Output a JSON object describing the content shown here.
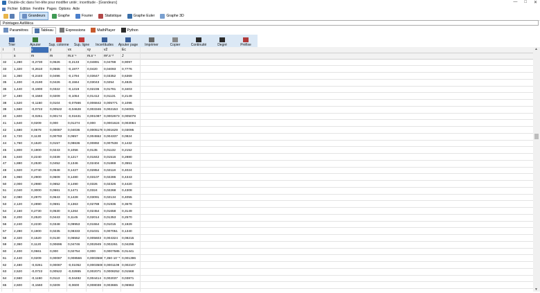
{
  "window": {
    "title": "Double-clic dans l'en-tête pour modifier unité ; incertitude - [Grandeurs]",
    "controls": [
      "—",
      "□",
      "✕"
    ]
  },
  "menu": [
    "Fichier",
    "Edition",
    "Fenêtre",
    "Pages",
    "Options",
    "Aide"
  ],
  "main_tabs": [
    {
      "label": "Grandeurs",
      "icon": "grid-icon",
      "active": true
    },
    {
      "label": "Graphe",
      "icon": "graph-icon"
    },
    {
      "label": "Fourier",
      "icon": "fourier-icon"
    },
    {
      "label": "Statistique",
      "icon": "statistics-icon"
    },
    {
      "label": "Graphe Euler",
      "icon": "euler-graph-icon"
    },
    {
      "label": "Graphe 3D",
      "icon": "graph-3d-icon"
    }
  ],
  "subtitle": "Pointages AviMéca",
  "sub_tabs": [
    {
      "label": "Paramètres",
      "icon": "parameters-icon"
    },
    {
      "label": "Tableau",
      "icon": "table-icon",
      "active": true
    },
    {
      "label": "Expressions",
      "icon": "expressions-icon"
    },
    {
      "label": "MathPlayer",
      "icon": "mathplayer-icon"
    },
    {
      "label": "Python",
      "icon": "python-icon"
    }
  ],
  "toolbar": [
    {
      "label": "Trier",
      "icon": "sort-icon"
    },
    {
      "label": "Ajouter",
      "icon": "add-icon"
    },
    {
      "label": "Sup. colonne",
      "icon": "delete-column-icon"
    },
    {
      "label": "Sup. ligne",
      "icon": "delete-row-icon"
    },
    {
      "label": "Incertitudes",
      "icon": "uncertainty-icon"
    },
    {
      "label": "Ajouter page",
      "icon": "add-page-icon"
    },
    {
      "label": "Imprimer",
      "icon": "print-icon"
    },
    {
      "label": "Copier",
      "icon": "copy-icon"
    },
    {
      "label": "Continuité",
      "icon": "continuity-icon"
    },
    {
      "label": "Degré",
      "icon": "degree-icon"
    },
    {
      "label": "Préfixe",
      "icon": "prefix-icon"
    }
  ],
  "table": {
    "headers": [
      "i",
      "t",
      "x",
      "y",
      "vx",
      "vy",
      "v2",
      "Ec"
    ],
    "units": [
      "",
      "s",
      "m",
      "m",
      "m.s⁻¹",
      "m.s⁻¹",
      "m².s⁻²",
      "J"
    ],
    "rows": [
      [
        "32",
        "1,280",
        "-0,2730",
        "0,0626",
        "-0,2133",
        "0,04891",
        "0,04788",
        "0,9097"
      ],
      [
        "33",
        "1,320",
        "-0,2610",
        "0,0565",
        "-0,1977",
        "0,0420",
        "0,04093",
        "0,7776"
      ],
      [
        "34",
        "1,360",
        "-0,2440",
        "0,0496",
        "-0,1794",
        "0,03647",
        "0,03352",
        "0,6369"
      ],
      [
        "35",
        "1,400",
        "-0,2190",
        "0,0426",
        "-0,1564",
        "0,03043",
        "0,0254",
        "0,4825"
      ],
      [
        "36",
        "1,440",
        "-0,1900",
        "0,0322",
        "-0,1319",
        "0,02236",
        "0,01781",
        "0,3403"
      ],
      [
        "37",
        "1,480",
        "-0,1560",
        "0,0209",
        "-0,1054",
        "0,01412",
        "0,01131",
        "0,2149"
      ],
      [
        "38",
        "1,520",
        "-0,1150",
        "0,0104",
        "-0,07566",
        "0,006842",
        "0,005771",
        "0,1096"
      ],
      [
        "39",
        "1,560",
        "-0,0722",
        "0,00522",
        "-0,04628",
        "0,003346",
        "0,002153",
        "0,04091"
      ],
      [
        "40",
        "1,600",
        "-0,0261",
        "0,00174",
        "-0,01631",
        "0,001087",
        "0,0002673",
        "0,005078"
      ],
      [
        "41",
        "1,640",
        "0,0209",
        "0,000",
        "0,01274",
        "0,000",
        "0,0001624",
        "0,003084"
      ],
      [
        "42",
        "1,680",
        "0,0678",
        "0,00087",
        "0,04036",
        "0,0005178",
        "0,001629",
        "0,03095"
      ],
      [
        "43",
        "1,720",
        "0,1130",
        "0,00783",
        "0,0657",
        "0,004552",
        "0,004337",
        "0,0824"
      ],
      [
        "44",
        "1,760",
        "0,1520",
        "0,0157",
        "0,08636",
        "0,00892",
        "0,007538",
        "0,1432"
      ],
      [
        "45",
        "1,800",
        "0,1900",
        "0,0243",
        "0,1056",
        "0,0135",
        "0,01132",
        "0,2152"
      ],
      [
        "46",
        "1,840",
        "0,2240",
        "0,0339",
        "0,1217",
        "0,01842",
        "0,01516",
        "0,2880"
      ],
      [
        "47",
        "1,880",
        "0,2530",
        "0,0452",
        "0,1346",
        "0,02404",
        "0,01869",
        "0,3551"
      ],
      [
        "48",
        "1,920",
        "0,2740",
        "0,0548",
        "0,1427",
        "0,02854",
        "0,02118",
        "0,4024"
      ],
      [
        "49",
        "1,960",
        "0,2900",
        "0,0609",
        "0,1480",
        "0,03107",
        "0,02286",
        "0,4343"
      ],
      [
        "50",
        "2,000",
        "0,2980",
        "0,0652",
        "0,1490",
        "0,0326",
        "0,02326",
        "0,4420"
      ],
      [
        "51",
        "2,040",
        "0,3000",
        "0,0661",
        "0,1471",
        "0,0324",
        "0,02268",
        "0,4308"
      ],
      [
        "52",
        "2,080",
        "0,2970",
        "0,0643",
        "0,1428",
        "0,03091",
        "0,02134",
        "0,4055"
      ],
      [
        "53",
        "2,120",
        "0,2890",
        "0,0591",
        "0,1363",
        "0,02788",
        "0,01936",
        "0,3678"
      ],
      [
        "54",
        "2,160",
        "0,2730",
        "0,0530",
        "0,1264",
        "0,02454",
        "0,01658",
        "0,3149"
      ],
      [
        "55",
        "2,200",
        "0,2520",
        "0,0443",
        "0,1145",
        "0,02014",
        "0,01353",
        "0,2570"
      ],
      [
        "56",
        "2,240",
        "0,2230",
        "0,0348",
        "0,09953",
        "0,01554",
        "0,01015",
        "0,1929"
      ],
      [
        "57",
        "2,280",
        "0,1900",
        "0,0235",
        "0,08333",
        "0,01031",
        "0,007051",
        "0,1340"
      ],
      [
        "58",
        "2,320",
        "0,1520",
        "0,0130",
        "0,06552",
        "0,005603",
        "0,004324",
        "0,08215"
      ],
      [
        "59",
        "2,360",
        "0,1120",
        "0,00696",
        "0,04746",
        "0,002949",
        "0,002261",
        "0,04296"
      ],
      [
        "60",
        "2,400",
        "0,0661",
        "0,000",
        "0,02754",
        "0,000",
        "0,0007585",
        "0,01441"
      ],
      [
        "61",
        "2,440",
        "0,0209",
        "0,00087",
        "0,008566",
        "0,0003566",
        "7,350·10⁻⁵",
        "0,001396"
      ],
      [
        "62",
        "2,480",
        "-0,0261",
        "0,00087",
        "-0,01052",
        "0,0003508",
        "0,0001109",
        "0,002107"
      ],
      [
        "63",
        "2,520",
        "-0,0722",
        "0,00522",
        "-0,02865",
        "0,002071",
        "0,0008252",
        "0,01568"
      ],
      [
        "64",
        "2,560",
        "-0,1150",
        "0,0113",
        "-0,04492",
        "0,004414",
        "0,002037",
        "0,03871"
      ],
      [
        "65",
        "2,600",
        "-0,1560",
        "0,0209",
        "-0,0600",
        "0,008038",
        "0,003665",
        "0,06963"
      ]
    ]
  },
  "colors": {
    "toolbar_bg": "#dbe8f5",
    "active_tab": "#cfe3f7",
    "header_bg": "#f2f2f2",
    "selected_header": "#3d6fb6"
  }
}
